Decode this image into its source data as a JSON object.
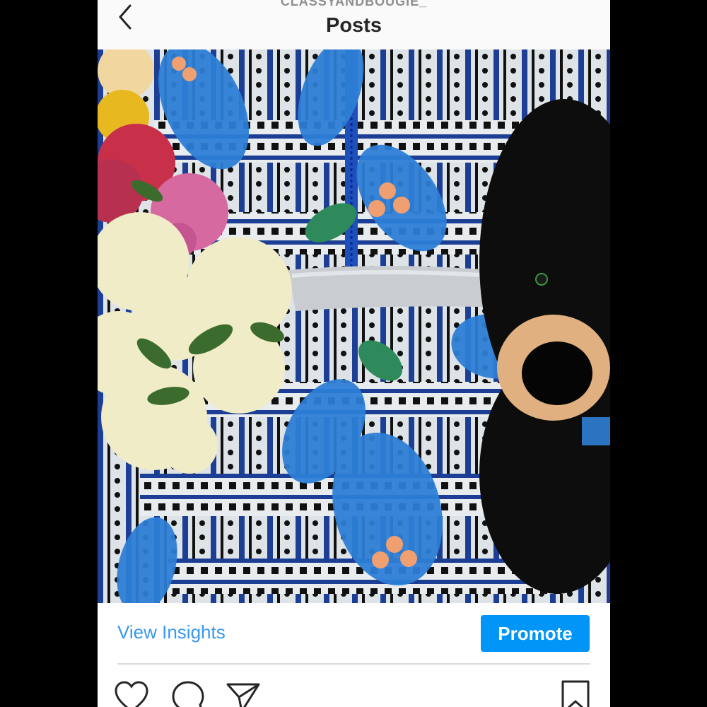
{
  "header": {
    "username": "CLASSYANDBOUGIE_",
    "title": "Posts",
    "back_icon": "chevron-left-icon"
  },
  "post": {
    "image_description_icon": "photo",
    "insights_link": "View Insights",
    "promote_label": "Promote"
  },
  "actions": {
    "icons": [
      "heart-icon",
      "comment-icon",
      "share-icon",
      "bookmark-icon"
    ]
  },
  "colors": {
    "accent": "#3897f0",
    "promote_bg": "#0095f6",
    "title": "#262626",
    "username": "#8e8e8e"
  }
}
